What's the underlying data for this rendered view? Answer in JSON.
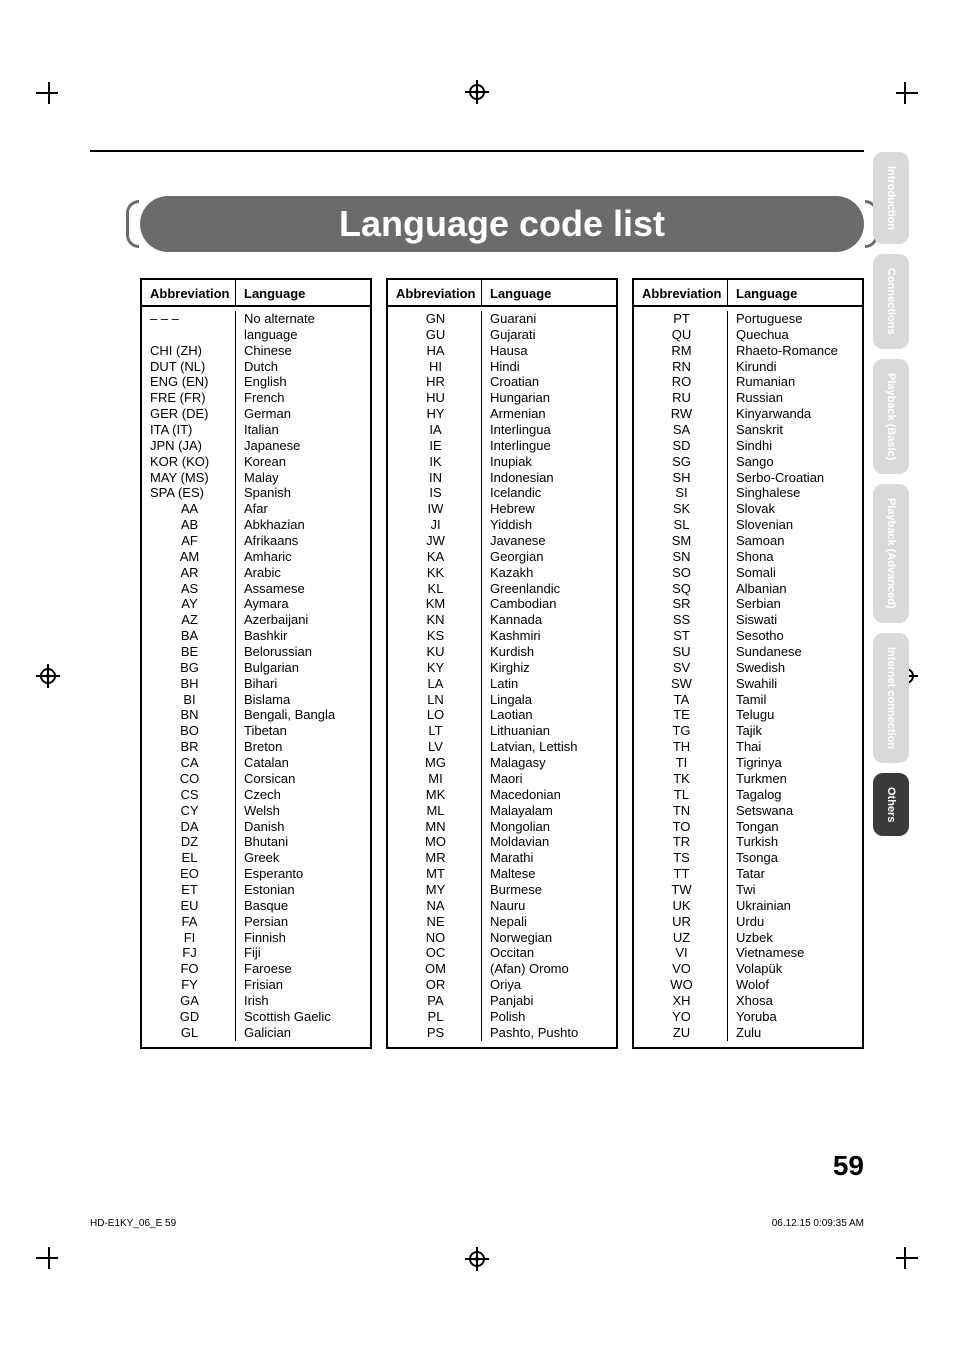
{
  "title": "Language code list",
  "page_number": "59",
  "footer_left": "HD-E1KY_06_E   59",
  "footer_right": "06.12.15   0:09:35 AM",
  "tabs": [
    {
      "label": "Introduction",
      "active": false
    },
    {
      "label": "Connections",
      "active": false
    },
    {
      "label": "Playback (Basic)",
      "active": false
    },
    {
      "label": "Playback (Advanced)",
      "active": false
    },
    {
      "label": "Internet connection",
      "active": false
    },
    {
      "label": "Others",
      "active": true
    }
  ],
  "headers": {
    "abbrev": "Abbreviation",
    "lang": "Language"
  },
  "col1": [
    {
      "a": "– – –",
      "l": "No alternate language"
    },
    {
      "a": "CHI (ZH)",
      "l": "Chinese"
    },
    {
      "a": "DUT (NL)",
      "l": "Dutch"
    },
    {
      "a": "ENG (EN)",
      "l": "English"
    },
    {
      "a": "FRE (FR)",
      "l": "French"
    },
    {
      "a": "GER (DE)",
      "l": "German"
    },
    {
      "a": "ITA (IT)",
      "l": "Italian"
    },
    {
      "a": "JPN (JA)",
      "l": "Japanese"
    },
    {
      "a": "KOR (KO)",
      "l": "Korean"
    },
    {
      "a": "MAY (MS)",
      "l": "Malay"
    },
    {
      "a": "SPA (ES)",
      "l": "Spanish"
    },
    {
      "a": "AA",
      "l": "Afar"
    },
    {
      "a": "AB",
      "l": "Abkhazian"
    },
    {
      "a": "AF",
      "l": "Afrikaans"
    },
    {
      "a": "AM",
      "l": "Amharic"
    },
    {
      "a": "AR",
      "l": "Arabic"
    },
    {
      "a": "AS",
      "l": "Assamese"
    },
    {
      "a": "AY",
      "l": "Aymara"
    },
    {
      "a": "AZ",
      "l": "Azerbaijani"
    },
    {
      "a": "BA",
      "l": "Bashkir"
    },
    {
      "a": "BE",
      "l": "Belorussian"
    },
    {
      "a": "BG",
      "l": "Bulgarian"
    },
    {
      "a": "BH",
      "l": "Bihari"
    },
    {
      "a": "BI",
      "l": "Bislama"
    },
    {
      "a": "BN",
      "l": "Bengali, Bangla"
    },
    {
      "a": "BO",
      "l": "Tibetan"
    },
    {
      "a": "BR",
      "l": "Breton"
    },
    {
      "a": "CA",
      "l": "Catalan"
    },
    {
      "a": "CO",
      "l": "Corsican"
    },
    {
      "a": "CS",
      "l": "Czech"
    },
    {
      "a": "CY",
      "l": "Welsh"
    },
    {
      "a": "DA",
      "l": "Danish"
    },
    {
      "a": "DZ",
      "l": "Bhutani"
    },
    {
      "a": "EL",
      "l": "Greek"
    },
    {
      "a": "EO",
      "l": "Esperanto"
    },
    {
      "a": "ET",
      "l": "Estonian"
    },
    {
      "a": "EU",
      "l": "Basque"
    },
    {
      "a": "FA",
      "l": "Persian"
    },
    {
      "a": "FI",
      "l": "Finnish"
    },
    {
      "a": "FJ",
      "l": "Fiji"
    },
    {
      "a": "FO",
      "l": "Faroese"
    },
    {
      "a": "FY",
      "l": "Frisian"
    },
    {
      "a": "GA",
      "l": "Irish"
    },
    {
      "a": "GD",
      "l": "Scottish Gaelic"
    },
    {
      "a": "GL",
      "l": "Galician"
    }
  ],
  "col2": [
    {
      "a": "GN",
      "l": "Guarani"
    },
    {
      "a": "GU",
      "l": "Gujarati"
    },
    {
      "a": "HA",
      "l": "Hausa"
    },
    {
      "a": "HI",
      "l": "Hindi"
    },
    {
      "a": "HR",
      "l": "Croatian"
    },
    {
      "a": "HU",
      "l": "Hungarian"
    },
    {
      "a": "HY",
      "l": "Armenian"
    },
    {
      "a": "IA",
      "l": "Interlingua"
    },
    {
      "a": "IE",
      "l": "Interlingue"
    },
    {
      "a": "IK",
      "l": "Inupiak"
    },
    {
      "a": "IN",
      "l": "Indonesian"
    },
    {
      "a": "IS",
      "l": "Icelandic"
    },
    {
      "a": "IW",
      "l": "Hebrew"
    },
    {
      "a": "JI",
      "l": "Yiddish"
    },
    {
      "a": "JW",
      "l": "Javanese"
    },
    {
      "a": "KA",
      "l": "Georgian"
    },
    {
      "a": "KK",
      "l": "Kazakh"
    },
    {
      "a": "KL",
      "l": "Greenlandic"
    },
    {
      "a": "KM",
      "l": "Cambodian"
    },
    {
      "a": "KN",
      "l": "Kannada"
    },
    {
      "a": "KS",
      "l": "Kashmiri"
    },
    {
      "a": "KU",
      "l": "Kurdish"
    },
    {
      "a": "KY",
      "l": "Kirghiz"
    },
    {
      "a": "LA",
      "l": "Latin"
    },
    {
      "a": "LN",
      "l": "Lingala"
    },
    {
      "a": "LO",
      "l": "Laotian"
    },
    {
      "a": "LT",
      "l": "Lithuanian"
    },
    {
      "a": "LV",
      "l": "Latvian, Lettish"
    },
    {
      "a": "MG",
      "l": "Malagasy"
    },
    {
      "a": "MI",
      "l": "Maori"
    },
    {
      "a": "MK",
      "l": "Macedonian"
    },
    {
      "a": "ML",
      "l": "Malayalam"
    },
    {
      "a": "MN",
      "l": "Mongolian"
    },
    {
      "a": "MO",
      "l": "Moldavian"
    },
    {
      "a": "MR",
      "l": "Marathi"
    },
    {
      "a": "MT",
      "l": "Maltese"
    },
    {
      "a": "MY",
      "l": "Burmese"
    },
    {
      "a": "NA",
      "l": "Nauru"
    },
    {
      "a": "NE",
      "l": "Nepali"
    },
    {
      "a": "NO",
      "l": "Norwegian"
    },
    {
      "a": "OC",
      "l": "Occitan"
    },
    {
      "a": "OM",
      "l": "(Afan) Oromo"
    },
    {
      "a": "OR",
      "l": "Oriya"
    },
    {
      "a": "PA",
      "l": "Panjabi"
    },
    {
      "a": "PL",
      "l": "Polish"
    },
    {
      "a": "PS",
      "l": "Pashto, Pushto"
    }
  ],
  "col3": [
    {
      "a": "PT",
      "l": "Portuguese"
    },
    {
      "a": "QU",
      "l": "Quechua"
    },
    {
      "a": "RM",
      "l": "Rhaeto-Romance"
    },
    {
      "a": "RN",
      "l": "Kirundi"
    },
    {
      "a": "RO",
      "l": "Rumanian"
    },
    {
      "a": "RU",
      "l": "Russian"
    },
    {
      "a": "RW",
      "l": "Kinyarwanda"
    },
    {
      "a": "SA",
      "l": "Sanskrit"
    },
    {
      "a": "SD",
      "l": "Sindhi"
    },
    {
      "a": "SG",
      "l": "Sango"
    },
    {
      "a": "SH",
      "l": "Serbo-Croatian"
    },
    {
      "a": "SI",
      "l": "Singhalese"
    },
    {
      "a": "SK",
      "l": "Slovak"
    },
    {
      "a": "SL",
      "l": "Slovenian"
    },
    {
      "a": "SM",
      "l": "Samoan"
    },
    {
      "a": "SN",
      "l": "Shona"
    },
    {
      "a": "SO",
      "l": "Somali"
    },
    {
      "a": "SQ",
      "l": "Albanian"
    },
    {
      "a": "SR",
      "l": "Serbian"
    },
    {
      "a": "SS",
      "l": "Siswati"
    },
    {
      "a": "ST",
      "l": "Sesotho"
    },
    {
      "a": "SU",
      "l": "Sundanese"
    },
    {
      "a": "SV",
      "l": "Swedish"
    },
    {
      "a": "SW",
      "l": "Swahili"
    },
    {
      "a": "TA",
      "l": "Tamil"
    },
    {
      "a": "TE",
      "l": "Telugu"
    },
    {
      "a": "TG",
      "l": "Tajik"
    },
    {
      "a": "TH",
      "l": "Thai"
    },
    {
      "a": "TI",
      "l": "Tigrinya"
    },
    {
      "a": "TK",
      "l": "Turkmen"
    },
    {
      "a": "TL",
      "l": "Tagalog"
    },
    {
      "a": "TN",
      "l": "Setswana"
    },
    {
      "a": "TO",
      "l": "Tongan"
    },
    {
      "a": "TR",
      "l": "Turkish"
    },
    {
      "a": "TS",
      "l": "Tsonga"
    },
    {
      "a": "TT",
      "l": "Tatar"
    },
    {
      "a": "TW",
      "l": "Twi"
    },
    {
      "a": "UK",
      "l": "Ukrainian"
    },
    {
      "a": "UR",
      "l": "Urdu"
    },
    {
      "a": "UZ",
      "l": "Uzbek"
    },
    {
      "a": "VI",
      "l": "Vietnamese"
    },
    {
      "a": "VO",
      "l": "Volapük"
    },
    {
      "a": "WO",
      "l": "Wolof"
    },
    {
      "a": "XH",
      "l": "Xhosa"
    },
    {
      "a": "YO",
      "l": "Yoruba"
    },
    {
      "a": "ZU",
      "l": "Zulu"
    }
  ]
}
